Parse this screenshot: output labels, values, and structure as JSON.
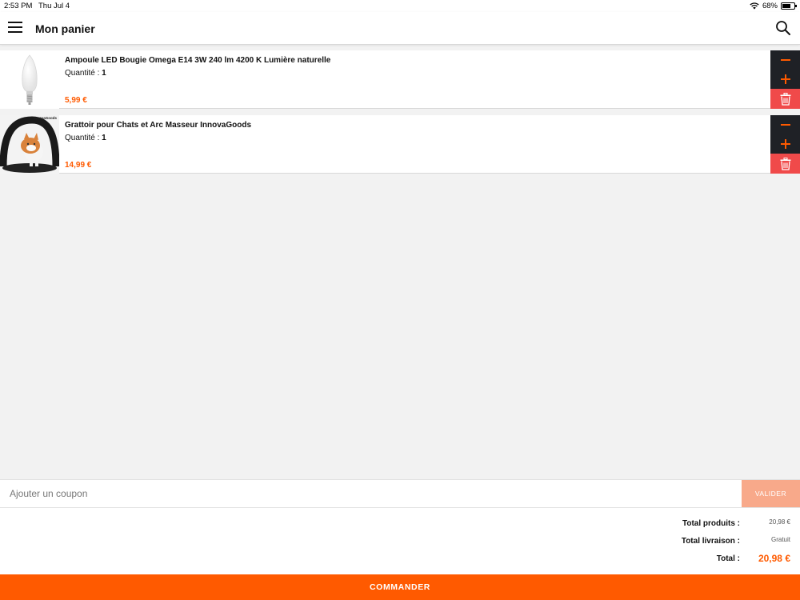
{
  "status_bar": {
    "time": "2:53 PM",
    "date": "Thu Jul 4",
    "battery": "68%",
    "battery_level": 0.68
  },
  "header": {
    "title": "Mon panier",
    "menu_icon": "hamburger-icon",
    "search_icon": "search-icon"
  },
  "cart": {
    "qty_label": "Quantité : ",
    "items": [
      {
        "name": "Ampoule LED Bougie Omega E14 3W 240 lm 4200 K Lumière naturelle",
        "quantity": "1",
        "price": "5,99 €"
      },
      {
        "name": "Grattoir pour Chats et Arc Masseur InnovaGoods",
        "quantity": "1",
        "price": "14,99 €",
        "brand_logo": "InnovaGoods"
      }
    ]
  },
  "coupon": {
    "placeholder": "Ajouter un coupon",
    "button_label": "VALIDER"
  },
  "totals": {
    "products_label": "Total produits :",
    "products_value": "20,98 €",
    "shipping_label": "Total livraison :",
    "shipping_value": "Gratuit",
    "total_label": "Total :",
    "total_value": "20,98 €"
  },
  "order_button": "COMMANDER",
  "colors": {
    "accent": "#ff5a00",
    "control_dark": "#1f2126",
    "delete_red": "#f04a4a",
    "coupon_button": "#f8a98a"
  }
}
